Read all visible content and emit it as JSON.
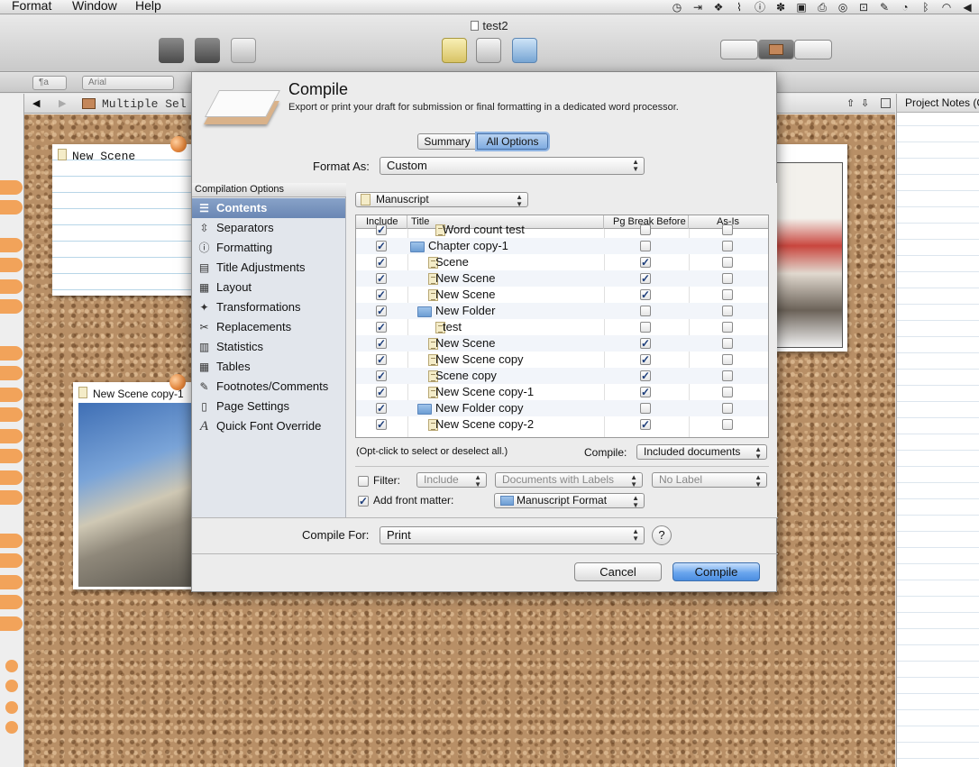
{
  "menubar": {
    "menus": [
      "Format",
      "Window",
      "Help"
    ],
    "status_icons": [
      "time-machine-icon",
      "arrow-icon",
      "dropbox-icon",
      "signal-icon",
      "info-icon",
      "paw-icon",
      "film-icon",
      "printer-icon",
      "shield-icon",
      "box-icon",
      "evernote-icon",
      "clock-icon",
      "bluetooth-icon",
      "wifi-icon",
      "volume-icon"
    ]
  },
  "window": {
    "title": "test2"
  },
  "formatbar": {
    "style_value": "¶a",
    "font_value": "Arial"
  },
  "header": {
    "title": "Multiple Sel"
  },
  "cards": [
    {
      "title": "New Scene"
    },
    {
      "title": "New Scene copy-1"
    }
  ],
  "notes": {
    "header": "Project Notes (C"
  },
  "compile": {
    "title": "Compile",
    "description": "Export or print your draft for submission or final formatting in a dedicated word processor.",
    "mode_tabs": [
      "Summary",
      "All Options"
    ],
    "selected_tab": "All Options",
    "format_as_label": "Format As:",
    "format_as_value": "Custom",
    "sidebar_header": "Compilation Options",
    "options": [
      {
        "label": "Contents",
        "icon": "contents-icon",
        "selected": true
      },
      {
        "label": "Separators",
        "icon": "separators-icon"
      },
      {
        "label": "Formatting",
        "icon": "formatting-icon"
      },
      {
        "label": "Title Adjustments",
        "icon": "title-adjust-icon"
      },
      {
        "label": "Layout",
        "icon": "layout-icon"
      },
      {
        "label": "Transformations",
        "icon": "transformations-icon"
      },
      {
        "label": "Replacements",
        "icon": "replacements-icon"
      },
      {
        "label": "Statistics",
        "icon": "statistics-icon"
      },
      {
        "label": "Tables",
        "icon": "tables-icon"
      },
      {
        "label": "Footnotes/Comments",
        "icon": "footnotes-icon"
      },
      {
        "label": "Page Settings",
        "icon": "page-settings-icon"
      },
      {
        "label": "Quick Font Override",
        "icon": "font-override-icon"
      }
    ],
    "draft_selector": "Manuscript",
    "table": {
      "headers": [
        "Include",
        "Title",
        "Pg Break Before",
        "As-Is"
      ],
      "rows": [
        {
          "title": "Word count test",
          "type": "doc",
          "indent": 2,
          "include": true,
          "pg_break": false,
          "as_is": false
        },
        {
          "title": "Chapter copy-1",
          "type": "folder",
          "indent": 0,
          "include": true,
          "pg_break": false,
          "as_is": false
        },
        {
          "title": "Scene",
          "type": "doc",
          "indent": 1,
          "include": true,
          "pg_break": true,
          "as_is": false
        },
        {
          "title": "New Scene",
          "type": "doc",
          "indent": 1,
          "include": true,
          "pg_break": true,
          "as_is": false
        },
        {
          "title": "New Scene",
          "type": "doc",
          "indent": 1,
          "include": true,
          "pg_break": true,
          "as_is": false
        },
        {
          "title": "New Folder",
          "type": "folder",
          "indent": 1,
          "include": true,
          "pg_break": false,
          "as_is": false
        },
        {
          "title": "test",
          "type": "doc",
          "indent": 2,
          "include": true,
          "pg_break": false,
          "as_is": false
        },
        {
          "title": "New Scene",
          "type": "doc",
          "indent": 1,
          "include": true,
          "pg_break": true,
          "as_is": false
        },
        {
          "title": "New Scene copy",
          "type": "doc",
          "indent": 1,
          "include": true,
          "pg_break": true,
          "as_is": false
        },
        {
          "title": "Scene copy",
          "type": "doc",
          "indent": 1,
          "include": true,
          "pg_break": true,
          "as_is": false
        },
        {
          "title": "New Scene copy-1",
          "type": "doc",
          "indent": 1,
          "include": true,
          "pg_break": true,
          "as_is": false
        },
        {
          "title": "New Folder copy",
          "type": "folder",
          "indent": 1,
          "include": true,
          "pg_break": false,
          "as_is": false
        },
        {
          "title": "New Scene copy-2",
          "type": "doc",
          "indent": 1,
          "include": true,
          "pg_break": true,
          "as_is": false
        }
      ]
    },
    "opt_click_hint": "(Opt-click to select or deselect all.)",
    "compile_label": "Compile:",
    "compile_value": "Included documents",
    "filter_label": "Filter:",
    "filter_checked": false,
    "filter_include": "Include",
    "filter_docs": "Documents with Labels",
    "filter_label_value": "No Label",
    "front_matter_label": "Add front matter:",
    "front_matter_checked": true,
    "front_matter_value": "Manuscript Format",
    "compile_for_label": "Compile For:",
    "compile_for_value": "Print",
    "help": "?",
    "cancel": "Cancel",
    "compile_button": "Compile"
  }
}
